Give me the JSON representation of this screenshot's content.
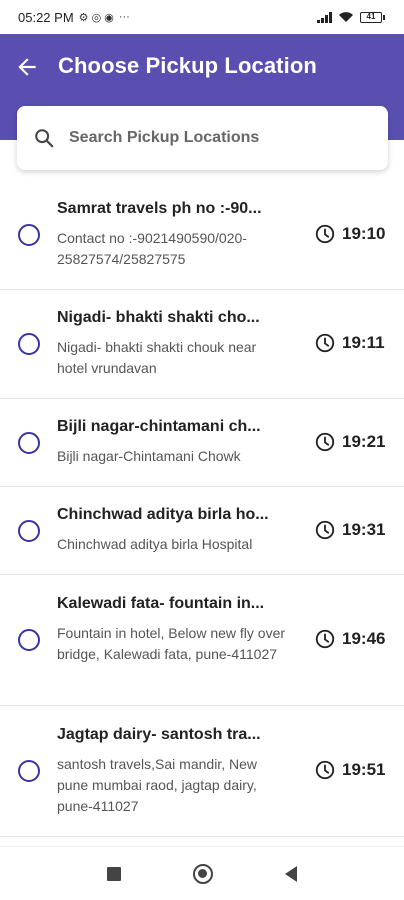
{
  "status_bar": {
    "time": "05:22 PM",
    "glyphs": "⚙ ◎ ◉",
    "more": "···",
    "battery": "41"
  },
  "app_bar": {
    "title": "Choose Pickup Location",
    "background": "#5a4fb0"
  },
  "search": {
    "placeholder": "Search Pickup Locations"
  },
  "locations": [
    {
      "title": "Samrat travels ph no :-90...",
      "desc": "Contact no :-9021490590/020-25827574/25827575",
      "time": "19:10"
    },
    {
      "title": "Nigadi- bhakti shakti cho...",
      "desc": "Nigadi- bhakti shakti chouk near hotel vrundavan",
      "time": "19:11"
    },
    {
      "title": "Bijli nagar-chintamani ch...",
      "desc": "Bijli nagar-Chintamani Chowk",
      "time": "19:21"
    },
    {
      "title": "Chinchwad aditya birla ho...",
      "desc": "Chinchwad aditya birla Hospital",
      "time": "19:31"
    },
    {
      "title": "Kalewadi fata- fountain in...",
      "desc": "Fountain in hotel, Below new fly over bridge, Kalewadi fata, pune-411027",
      "time": "19:46"
    },
    {
      "title": "Jagtap dairy- santosh tra...",
      "desc": "santosh travels,Sai mandir, New pune mumbai raod, jagtap dairy, pune-411027",
      "time": "19:51"
    }
  ],
  "icons": {
    "back": "arrow-left-icon",
    "search": "search-icon",
    "clock": "clock-icon",
    "radio": "radio-unselected-icon"
  }
}
